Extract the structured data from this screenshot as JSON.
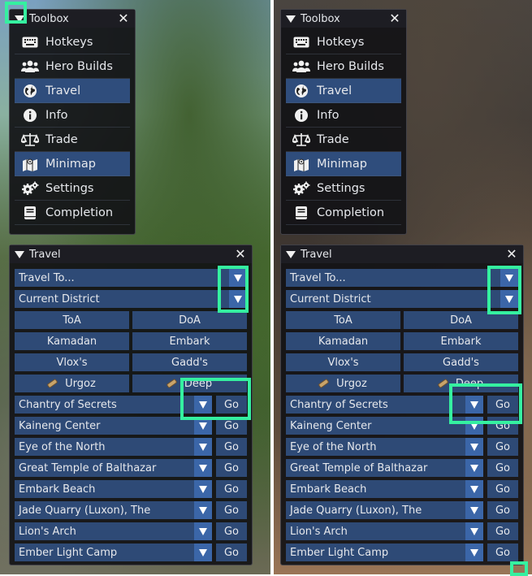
{
  "toolbox": {
    "title": "Toolbox",
    "items": [
      {
        "label": "Hotkeys",
        "icon": "keyboard-icon",
        "selected": false
      },
      {
        "label": "Hero Builds",
        "icon": "users-icon",
        "selected": false
      },
      {
        "label": "Travel",
        "icon": "globe-icon",
        "selected": true
      },
      {
        "label": "Info",
        "icon": "info-icon",
        "selected": false
      },
      {
        "label": "Trade",
        "icon": "balance-scale-icon",
        "selected": false
      },
      {
        "label": "Minimap",
        "icon": "map-icon",
        "selected": true
      },
      {
        "label": "Settings",
        "icon": "gears-icon",
        "selected": false
      },
      {
        "label": "Completion",
        "icon": "book-icon",
        "selected": false
      }
    ]
  },
  "travel": {
    "title": "Travel",
    "travel_to": "Travel To...",
    "district": "Current District",
    "quick": [
      [
        "ToA",
        "DoA"
      ],
      [
        "Kamadan",
        "Embark"
      ],
      [
        "Vlox's",
        "Gadd's"
      ],
      [
        "Urgoz",
        "Deep"
      ]
    ],
    "go_label": "Go",
    "favorites": [
      "Chantry of Secrets",
      "Kaineng Center",
      "Eye of the North",
      "Great Temple of Balthazar",
      "Embark Beach",
      "Jade Quarry (Luxon), The",
      "Lion's Arch",
      "Ember Light Camp"
    ]
  },
  "colors": {
    "highlight": "#35f0a0",
    "selected_item": "#2f4d7c",
    "button": "#2e4a76",
    "arrow_button": "#3b66a8"
  }
}
